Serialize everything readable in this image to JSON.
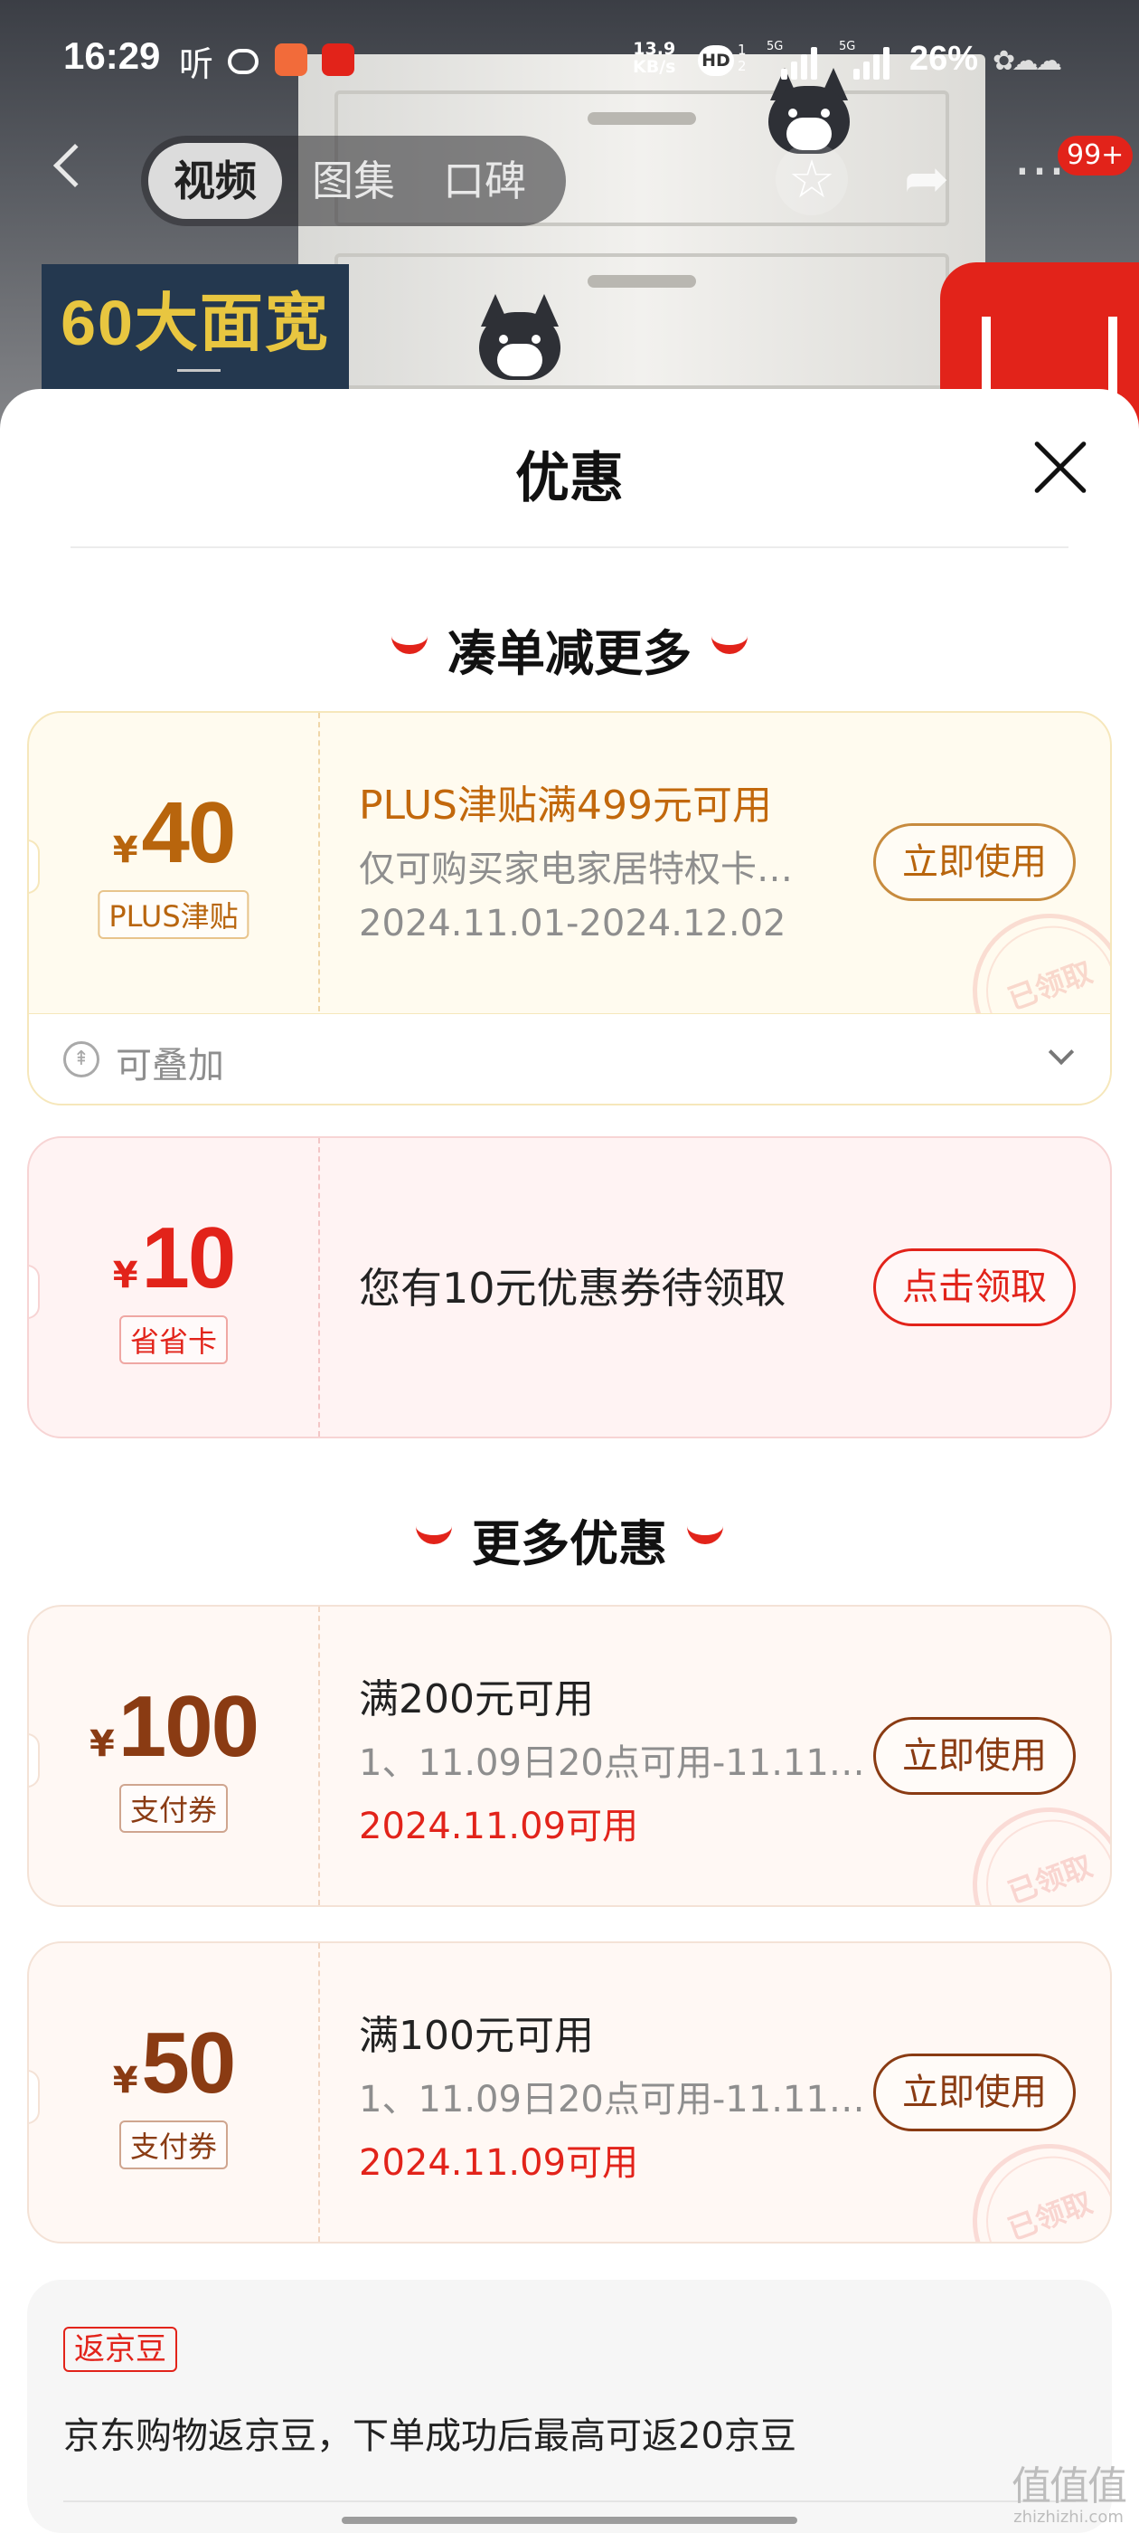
{
  "status_bar": {
    "time": "16:29",
    "listen": "听",
    "net_speed_value": "13.9",
    "net_speed_unit": "KB/s",
    "hd": "HD",
    "hd_sub": "1 2",
    "sig1_tag": "5G",
    "sig2_tag": "5G",
    "battery": "26%",
    "app_icon_colors": [
      "#ffffff",
      "#f26b3a",
      "#e2231a"
    ]
  },
  "nav": {
    "tabs": [
      {
        "label": "视频",
        "active": true
      },
      {
        "label": "图集",
        "active": false
      },
      {
        "label": "口碑",
        "active": false
      }
    ],
    "badge": "99+",
    "icons": [
      "back-icon",
      "star-icon",
      "share-icon",
      "more-icon"
    ]
  },
  "background": {
    "banner_text": "60大面宽"
  },
  "sheet": {
    "title": "优惠",
    "section1_title": "凑单减更多",
    "section2_title": "更多优惠",
    "coupons_1": [
      {
        "currency": "¥",
        "amount": "40",
        "tag": "PLUS津贴",
        "title": "PLUS津贴满499元可用",
        "desc": "仅可购买家电家居特权卡…",
        "date": "2024.11.01-2024.12.02",
        "button": "立即使用",
        "stamp": "已领取",
        "stack_label": "可叠加"
      },
      {
        "currency": "¥",
        "amount": "10",
        "tag": "省省卡",
        "title": "您有10元优惠券待领取",
        "button": "点击领取"
      }
    ],
    "coupons_2": [
      {
        "currency": "¥",
        "amount": "100",
        "tag": "支付券",
        "title": "满200元可用",
        "desc": "1、11.09日20点可用-11.11…",
        "date": "2024.11.09可用",
        "button": "立即使用",
        "stamp": "已领取"
      },
      {
        "currency": "¥",
        "amount": "50",
        "tag": "支付券",
        "title": "满100元可用",
        "desc": "1、11.09日20点可用-11.11…",
        "date": "2024.11.09可用",
        "button": "立即使用",
        "stamp": "已领取"
      }
    ],
    "beans": {
      "tag": "返京豆",
      "text": "京东购物返京豆，下单成功后最高可返20京豆"
    }
  },
  "watermark": {
    "glyphs": "值值值",
    "url": "zhizhizhi.com"
  },
  "colors": {
    "accent_red": "#e2231a",
    "plus_gold": "#b8650d",
    "pay_brown": "#8a3b13"
  }
}
